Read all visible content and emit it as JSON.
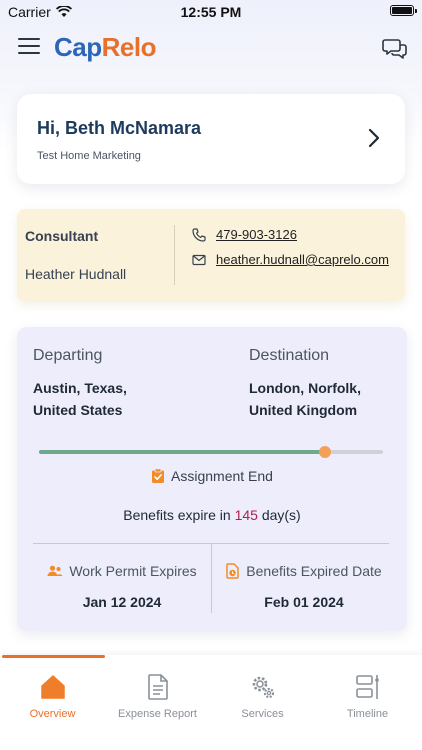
{
  "status_bar": {
    "carrier": "Carrier",
    "time": "12:55 PM"
  },
  "header": {
    "logo_part1": "Cap",
    "logo_part2": "Relo"
  },
  "greeting": {
    "name": "Hi, Beth McNamara",
    "subtitle": "Test Home Marketing"
  },
  "consultant": {
    "label": "Consultant",
    "name": "Heather Hudnall",
    "phone": "479-903-3126",
    "email": "heather.hudnall@caprelo.com"
  },
  "assignment": {
    "departing_label": "Departing",
    "departing_line1": "Austin, Texas,",
    "departing_line2": "United States",
    "destination_label": "Destination",
    "destination_line1": "London, Norfolk,",
    "destination_line2": "United Kingdom",
    "progress": 0.83,
    "assignment_end_label": "Assignment End",
    "benefits_prefix": "Benefits expire in",
    "benefits_days": "145",
    "benefits_suffix": "day(s)",
    "work_permit_label": "Work Permit Expires",
    "work_permit_date": "Jan 12 2024",
    "benefits_expired_label": "Benefits Expired Date",
    "benefits_expired_date": "Feb 01 2024"
  },
  "tabs": [
    {
      "label": "Overview",
      "icon": "home-icon",
      "active": true
    },
    {
      "label": "Expense Report",
      "icon": "document-icon",
      "active": false
    },
    {
      "label": "Services",
      "icon": "gears-icon",
      "active": false
    },
    {
      "label": "Timeline",
      "icon": "timeline-icon",
      "active": false
    }
  ],
  "colors": {
    "brand_blue": "#2d66b8",
    "brand_orange": "#e8702a",
    "progress_green": "#6fa98b",
    "days_red": "#b41f4b"
  }
}
